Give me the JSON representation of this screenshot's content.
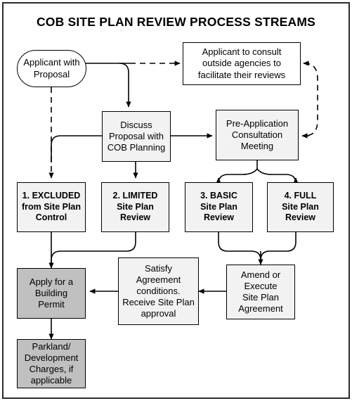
{
  "title": "COB SITE PLAN REVIEW PROCESS STREAMS",
  "colors": {
    "frame_border": "#2b2b2b",
    "node_border": "#000000",
    "fill_light": "#f2f2f2",
    "fill_white": "#ffffff",
    "fill_gray": "#c0c0c0",
    "connector": "#000000",
    "text": "#000000"
  },
  "nodes": {
    "applicant": {
      "label": "Applicant with\nProposal",
      "shape": "rounded-pill",
      "fill": "#ffffff"
    },
    "consult": {
      "label": "Applicant to consult\noutside agencies to\nfacilitate their reviews",
      "shape": "rectangle",
      "fill": "#ffffff"
    },
    "discuss": {
      "label": "Discuss\nProposal with\nCOB Planning",
      "shape": "rectangle",
      "fill": "#f2f2f2"
    },
    "preapp": {
      "label": "Pre-Application\nConsultation\nMeeting",
      "shape": "rectangle",
      "fill": "#f2f2f2"
    },
    "stream1": {
      "label": "1. EXCLUDED\nfrom Site Plan\nControl",
      "shape": "rectangle",
      "fill": "#f2f2f2",
      "bold": true
    },
    "stream2": {
      "label": "2. LIMITED\nSite Plan\nReview",
      "shape": "rectangle",
      "fill": "#f2f2f2",
      "bold": true
    },
    "stream3": {
      "label": "3. BASIC\nSite Plan\nReview",
      "shape": "rectangle",
      "fill": "#f2f2f2",
      "bold": true
    },
    "stream4": {
      "label": "4. FULL\nSite Plan\nReview",
      "shape": "rectangle",
      "fill": "#f2f2f2",
      "bold": true
    },
    "building_permit": {
      "label": "Apply for a\nBuilding\nPermit",
      "shape": "rectangle",
      "fill": "#c0c0c0"
    },
    "parkland": {
      "label": "Parkland/\nDevelopment\nCharges, if\napplicable",
      "shape": "rectangle",
      "fill": "#c0c0c0"
    },
    "satisfy": {
      "label": "Satisfy\nAgreement\nconditions.\nReceive Site Plan\napproval",
      "shape": "rectangle",
      "fill": "#f2f2f2"
    },
    "amend": {
      "label": "Amend or\nExecute\nSite Plan\nAgreement",
      "shape": "rectangle",
      "fill": "#f2f2f2"
    }
  },
  "connectors": [
    {
      "name": "applicant-to-consult",
      "from": "applicant",
      "to": "consult",
      "style": "dashed",
      "arrow": true
    },
    {
      "name": "applicant-to-discuss",
      "from": "applicant",
      "to": "discuss",
      "style": "solid",
      "arrow": true
    },
    {
      "name": "applicant-to-stream1",
      "from": "applicant",
      "to": "stream1",
      "style": "dashed",
      "arrow": true
    },
    {
      "name": "discuss-to-preapp",
      "from": "discuss",
      "to": "preapp",
      "style": "solid",
      "arrow": true
    },
    {
      "name": "discuss-to-stream1",
      "from": "discuss",
      "to": "stream1",
      "style": "solid",
      "arrow": false
    },
    {
      "name": "discuss-to-stream2",
      "from": "discuss",
      "to": "stream2",
      "style": "solid",
      "arrow": true
    },
    {
      "name": "preapp-to-consult-loop",
      "from": "preapp",
      "to": "consult",
      "style": "dashed",
      "arrow": true
    },
    {
      "name": "consult-to-preapp-loop",
      "from": "consult",
      "to": "preapp",
      "style": "dashed",
      "arrow": true
    },
    {
      "name": "preapp-to-stream3",
      "from": "preapp",
      "to": "stream3",
      "style": "solid",
      "arrow": true
    },
    {
      "name": "preapp-to-stream4",
      "from": "preapp",
      "to": "stream4",
      "style": "solid",
      "arrow": true
    },
    {
      "name": "stream1-to-building-permit",
      "from": "stream1",
      "to": "building_permit",
      "style": "solid",
      "arrow": true
    },
    {
      "name": "stream2-to-building-permit",
      "from": "stream2",
      "to": "building_permit",
      "style": "solid",
      "arrow": false
    },
    {
      "name": "stream3-to-amend",
      "from": "stream3",
      "to": "amend",
      "style": "solid",
      "arrow": true
    },
    {
      "name": "stream4-to-amend",
      "from": "stream4",
      "to": "amend",
      "style": "solid",
      "arrow": false
    },
    {
      "name": "amend-to-satisfy",
      "from": "amend",
      "to": "satisfy",
      "style": "solid",
      "arrow": true
    },
    {
      "name": "satisfy-to-building-permit",
      "from": "satisfy",
      "to": "building_permit",
      "style": "solid",
      "arrow": true
    },
    {
      "name": "building-permit-to-parkland",
      "from": "building_permit",
      "to": "parkland",
      "style": "solid",
      "arrow": true
    }
  ]
}
